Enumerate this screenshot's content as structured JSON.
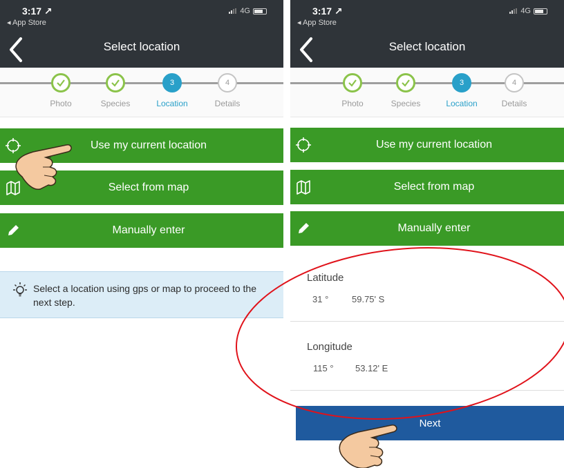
{
  "status_bar": {
    "time": "3:17 ↗",
    "back_app": "◂ App Store",
    "network": "4G"
  },
  "header": {
    "title": "Select location"
  },
  "stepper": {
    "steps": [
      {
        "label": "Photo",
        "number": "1",
        "state": "done"
      },
      {
        "label": "Species",
        "number": "2",
        "state": "done"
      },
      {
        "label": "Location",
        "number": "3",
        "state": "active"
      },
      {
        "label": "Details",
        "number": "4",
        "state": "pending"
      }
    ]
  },
  "actions": {
    "current_location": "Use my current location",
    "select_map": "Select from map",
    "manual_enter": "Manually enter"
  },
  "hint": {
    "text": "Select a location using gps or map to proceed to the next step."
  },
  "coordinates": {
    "latitude": {
      "label": "Latitude",
      "degrees": "31 °",
      "minutes": "59.75' S"
    },
    "longitude": {
      "label": "Longitude",
      "degrees": "115 °",
      "minutes": "53.12' E"
    }
  },
  "next_button": {
    "label": "Next"
  },
  "colors": {
    "header_bg": "#2f3439",
    "action_green": "#3a9a26",
    "active_step_blue": "#29a0c9",
    "next_blue": "#1f5a9e",
    "hint_bg": "#dcedf7",
    "annotation_red": "#e0121a"
  },
  "icons": {
    "back": "chevron-left-icon",
    "current_location": "crosshair-icon",
    "select_map": "map-icon",
    "manual_enter": "pencil-icon",
    "hint": "lightbulb-icon",
    "step_done": "checkmark-icon",
    "pointer": "pointing-hand-icon"
  }
}
